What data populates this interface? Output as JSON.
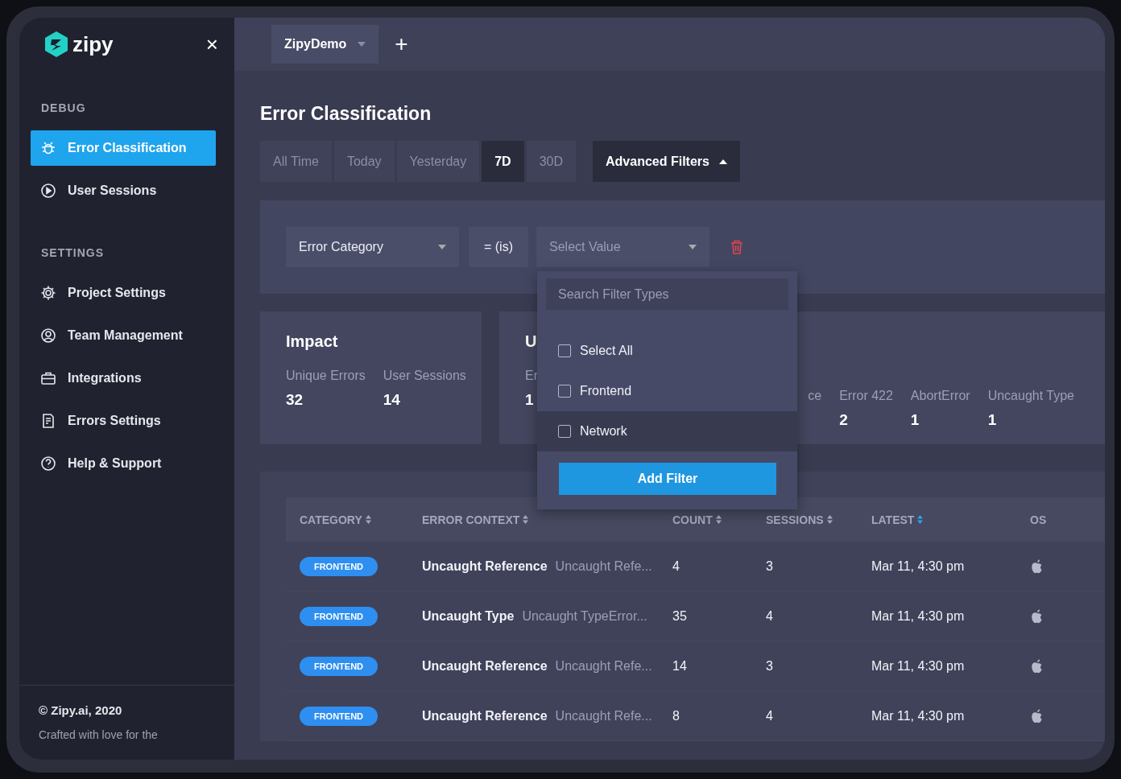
{
  "sidebar": {
    "logo": "zipy",
    "close": "×",
    "sections": [
      {
        "heading": "DEBUG",
        "items": [
          {
            "kind": "bug",
            "label": "Error Classification",
            "selected": true
          },
          {
            "kind": "play",
            "label": "User Sessions",
            "selected": false
          }
        ]
      },
      {
        "heading": "SETTINGS",
        "items": [
          {
            "kind": "gear",
            "label": "Project Settings",
            "selected": false
          },
          {
            "kind": "user",
            "label": "Team Management",
            "selected": false
          },
          {
            "kind": "briefcase",
            "label": "Integrations",
            "selected": false
          },
          {
            "kind": "doc",
            "label": "Errors Settings",
            "selected": false
          },
          {
            "kind": "help",
            "label": "Help & Support",
            "selected": false
          }
        ]
      }
    ],
    "footer": {
      "copyright": "© Zipy.ai, 2020",
      "tagline": "Crafted with love for the"
    }
  },
  "top_bar": {
    "project": "ZipyDemo",
    "add": "+"
  },
  "title": "Error Classification",
  "date_ranges": [
    {
      "label": "All Time",
      "selected": false
    },
    {
      "label": "Today",
      "selected": false
    },
    {
      "label": "Yesterday",
      "selected": false
    },
    {
      "label": "7D",
      "selected": true
    },
    {
      "label": "30D",
      "selected": false
    }
  ],
  "advanced_filters": {
    "label": "Advanced Filters",
    "expanded": true
  },
  "filter": {
    "field": "Error Category",
    "operator": "= (is)",
    "value_placeholder": "Select Value",
    "dropdown": {
      "placeholder": "Search Filter Types",
      "options": [
        {
          "label": "Select All",
          "checked": false,
          "highlighted": false
        },
        {
          "label": "Frontend",
          "checked": false,
          "highlighted": false
        },
        {
          "label": "Network",
          "checked": false,
          "highlighted": true
        }
      ],
      "button": "Add Filter"
    }
  },
  "impact": {
    "title": "Impact",
    "stats": [
      {
        "label": "Unique Errors",
        "value": "32"
      },
      {
        "label": "User Sessions",
        "value": "14"
      }
    ]
  },
  "types_card": {
    "title": "U",
    "left_stats": [
      {
        "label": "Er",
        "value": "1"
      }
    ],
    "right_stats": [
      {
        "label": "ce"
      },
      {
        "label": "Error 422",
        "value": "2"
      },
      {
        "label": "AbortError",
        "value": "1"
      },
      {
        "label": "Uncaught Type",
        "value": "1"
      }
    ]
  },
  "table": {
    "columns": [
      {
        "label": "CATEGORY",
        "sort_active": false
      },
      {
        "label": "ERROR CONTEXT",
        "sort_active": false
      },
      {
        "label": "COUNT",
        "sort_active": false
      },
      {
        "label": "SESSIONS",
        "sort_active": false
      },
      {
        "label": "LATEST",
        "sort_active": true
      },
      {
        "label": "OS"
      }
    ],
    "rows": [
      {
        "category": "FRONTEND",
        "error": "Uncaught Reference",
        "context": "Uncaught Refe...",
        "count": "4",
        "sessions": "3",
        "latest": "Mar 11, 4:30 pm"
      },
      {
        "category": "FRONTEND",
        "error": "Uncaught Type",
        "context": "Uncaught TypeError...",
        "count": "35",
        "sessions": "4",
        "latest": "Mar 11, 4:30 pm"
      },
      {
        "category": "FRONTEND",
        "error": "Uncaught Reference",
        "context": "Uncaught Refe...",
        "count": "14",
        "sessions": "3",
        "latest": "Mar 11, 4:30 pm"
      },
      {
        "category": "FRONTEND",
        "error": "Uncaught Reference",
        "context": "Uncaught Refe...",
        "count": "8",
        "sessions": "4",
        "latest": "Mar 11, 4:30 pm"
      }
    ]
  }
}
